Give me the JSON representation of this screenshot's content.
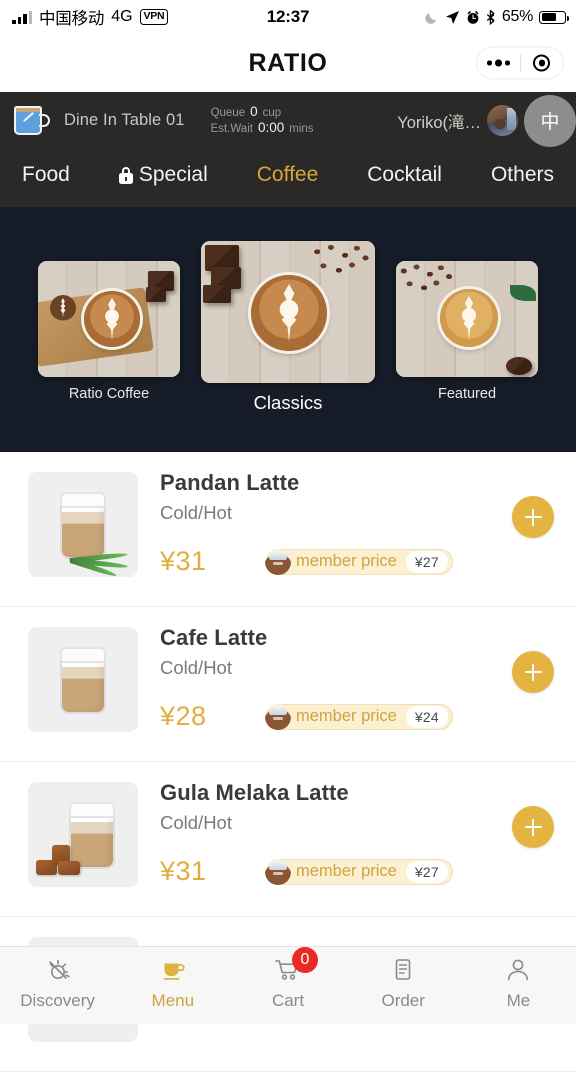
{
  "status_bar": {
    "carrier": "中国移动",
    "network": "4G",
    "vpn": "VPN",
    "time": "12:37",
    "battery_percent": "65%",
    "icons": [
      "signal-icon",
      "moon-icon",
      "location-icon",
      "alarm-icon",
      "bluetooth-icon",
      "battery-icon"
    ]
  },
  "header": {
    "title": "RATIO",
    "capsule": {
      "menu_icon": "more-dots-icon",
      "close_icon": "target-circle-icon"
    }
  },
  "store_bar": {
    "mug_icon": "coffee-mug-icon",
    "table_label": "Dine In Table  01",
    "queue": {
      "label": "Queue",
      "value": "0",
      "unit": "cup"
    },
    "est_wait": {
      "label": "Est.Wait",
      "value": "0:00",
      "unit": "mins"
    },
    "user_name": "Yoriko(滝…",
    "avatar": "user-avatar",
    "language_toggle": "中"
  },
  "categories": [
    {
      "label": "Food",
      "icon": null,
      "active": false
    },
    {
      "label": "Special",
      "icon": "lock-icon",
      "active": false
    },
    {
      "label": "Coffee",
      "icon": null,
      "active": true
    },
    {
      "label": "Cocktail",
      "icon": null,
      "active": false
    },
    {
      "label": "Others",
      "icon": null,
      "active": false
    }
  ],
  "carousel": {
    "slides": [
      {
        "caption": "Ratio Coffee",
        "position": "left"
      },
      {
        "caption": "Classics",
        "position": "center"
      },
      {
        "caption": "Featured",
        "position": "right"
      }
    ],
    "active_index": 1
  },
  "products": [
    {
      "name": "Pandan Latte",
      "options": "Cold/Hot",
      "price": "¥31",
      "member_label": "member price",
      "member_price": "¥27",
      "add_button": "+",
      "thumb": "pandan-latte-photo"
    },
    {
      "name": "Cafe Latte",
      "options": "Cold/Hot",
      "price": "¥28",
      "member_label": "member price",
      "member_price": "¥24",
      "add_button": "+",
      "thumb": "cafe-latte-photo"
    },
    {
      "name": "Gula Melaka Latte",
      "options": "Cold/Hot",
      "price": "¥31",
      "member_label": "member price",
      "member_price": "¥27",
      "add_button": "+",
      "thumb": "gula-melaka-latte-photo"
    }
  ],
  "tab_bar": {
    "items": [
      {
        "label": "Discovery",
        "icon": "discovery-icon",
        "active": false
      },
      {
        "label": "Menu",
        "icon": "coffee-cup-icon",
        "active": true
      },
      {
        "label": "Cart",
        "icon": "shopping-cart-icon",
        "active": false,
        "badge": "0"
      },
      {
        "label": "Order",
        "icon": "document-icon",
        "active": false
      },
      {
        "label": "Me",
        "icon": "person-icon",
        "active": false
      }
    ]
  },
  "colors": {
    "accent_gold": "#e5b33f",
    "active_tab_gold": "#d6a43a",
    "store_bar_dark": "#2b2927",
    "carousel_dark": "#161d28",
    "badge_red": "#ec2a24",
    "member_bg": "#fbf0d2"
  }
}
